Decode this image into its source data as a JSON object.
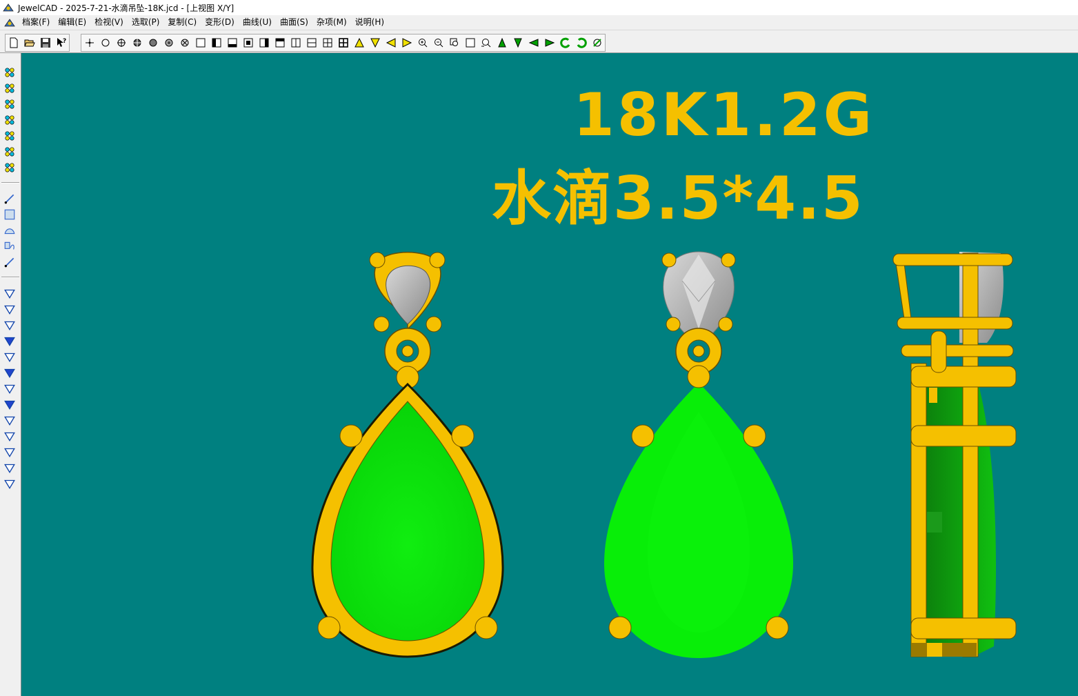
{
  "window": {
    "title": "JewelCAD - 2025-7-21-水滴吊坠-18K.jcd - [上视图 X/Y]"
  },
  "menu": [
    "档案(F)",
    "编辑(E)",
    "检视(V)",
    "选取(P)",
    "复制(C)",
    "变形(D)",
    "曲线(U)",
    "曲面(S)",
    "杂项(M)",
    "说明(H)"
  ],
  "toolbar": {
    "file_buttons": [
      "new-file-icon",
      "open-file-icon",
      "save-file-icon",
      "help-pointer-icon"
    ],
    "view_buttons": [
      "point-mode-icon",
      "circle-outline-icon",
      "crosshair-circle-icon",
      "filled-crosshair-icon",
      "solid-sphere-icon",
      "shaded-sphere-icon",
      "xray-sphere-icon",
      "view-single-icon",
      "view-left-icon",
      "view-bottom-icon",
      "view-center-icon",
      "view-right-icon",
      "view-top-icon",
      "view-split-vertical-icon",
      "view-split-horizontal-icon",
      "view-quad-icon",
      "view-grid-icon",
      "arrow-up-icon",
      "arrow-down-icon",
      "arrow-left-icon",
      "arrow-right-icon",
      "zoom-in-icon",
      "zoom-out-icon",
      "zoom-window-icon",
      "zoom-fit-icon",
      "zoom-realtime-icon",
      "rotate-up-icon",
      "rotate-down-icon",
      "rotate-left-icon",
      "rotate-right-icon",
      "rotate-ccw-icon",
      "rotate-cw-icon",
      "reset-view-icon"
    ]
  },
  "leftbar": {
    "groups": [
      [
        "select-pointer-icon",
        "select-pair-icon",
        "select-stack-icon",
        "select-chain-icon",
        "select-grid-icon",
        "select-diagonal-icon",
        "select-cluster-icon"
      ],
      [
        "curve-pen-icon",
        "rectangle-curve-icon",
        "arc-curve-icon",
        "shape-curve-icon",
        "point-add-icon"
      ],
      [
        "surface-arc-icon",
        "surface-rotate-icon",
        "surface-cone-icon",
        "surface-cone-filled-icon",
        "surface-funnel-icon",
        "surface-funnel-filled-icon",
        "surface-slant-icon",
        "surface-slant-filled-icon",
        "surface-bowtie-icon",
        "surface-loop-icon",
        "surface-wave-icon",
        "surface-tube-icon",
        "surface-arrows-icon"
      ]
    ]
  },
  "viewport": {
    "background": "#008080",
    "label_line_1": "18K1.2G",
    "label_line_2": "水滴3.5*4.5",
    "gold_color": "#f5c000",
    "gem_color": "#0ae30a",
    "stone_color": "#b8b8b8"
  }
}
